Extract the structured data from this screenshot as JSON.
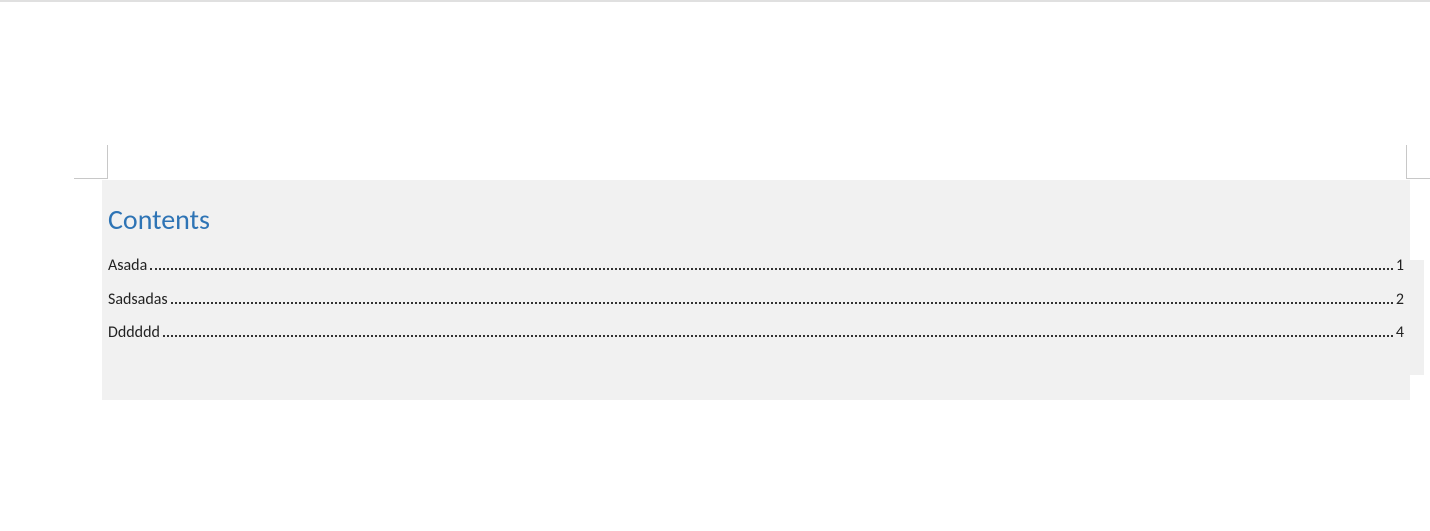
{
  "toc": {
    "title": "Contents",
    "entries": [
      {
        "title": "Asada",
        "page": "1"
      },
      {
        "title": "Sadsadas",
        "page": "2"
      },
      {
        "title": "Dddddd",
        "page": "4"
      }
    ]
  }
}
